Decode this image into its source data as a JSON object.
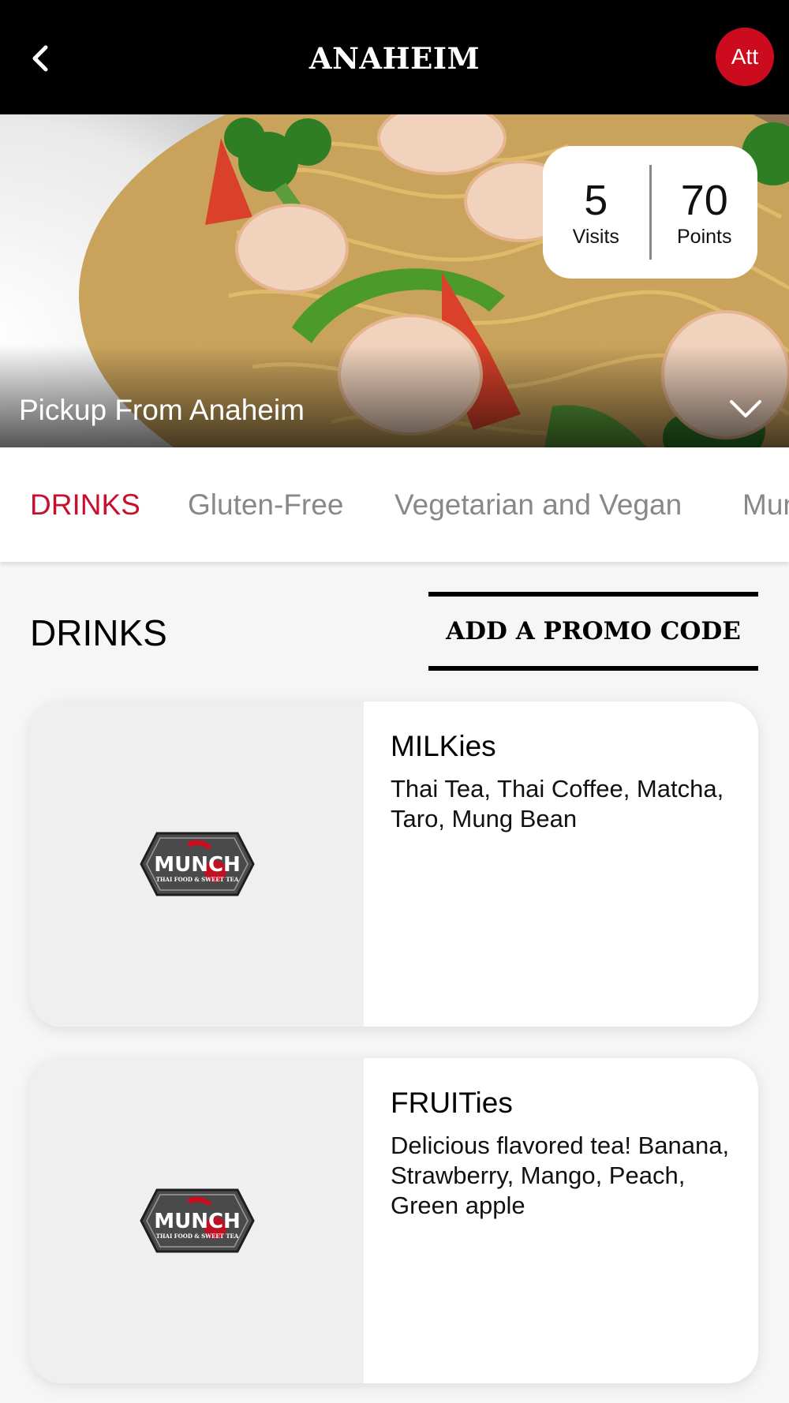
{
  "header": {
    "title": "ANAHEIM",
    "avatar_initials": "Att"
  },
  "stats": {
    "visits_value": "5",
    "visits_label": "Visits",
    "points_value": "70",
    "points_label": "Points"
  },
  "location": {
    "pickup_label": "Pickup From Anaheim"
  },
  "tabs": [
    {
      "label": "DRINKS"
    },
    {
      "label": "Gluten-Free"
    },
    {
      "label": "Vegetarian and Vegan"
    },
    {
      "label": "Munch"
    }
  ],
  "section": {
    "title": "DRINKS",
    "promo_label": "ADD A PROMO CODE"
  },
  "items": [
    {
      "title": "MILKies",
      "description": "Thai Tea, Thai Coffee, Matcha, Taro, Mung Bean"
    },
    {
      "title": "FRUITies",
      "description": "Delicious flavored tea! Banana, Strawberry, Mango, Peach, Green apple"
    }
  ],
  "logo": {
    "name": "MUNCH",
    "tagline": "THAI FOOD & SWEET TEA"
  },
  "colors": {
    "brand_red": "#cc0b1f",
    "active_tab": "#c8102e",
    "header_bg": "#000000"
  }
}
